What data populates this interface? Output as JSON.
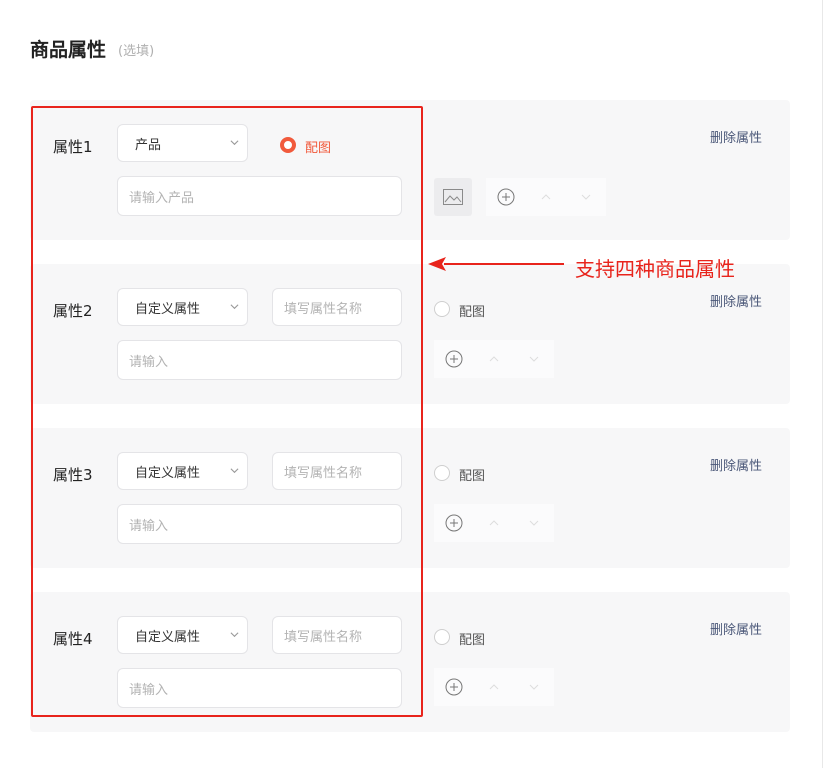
{
  "section": {
    "title": "商品属性",
    "hint": "(选填)"
  },
  "annotation": {
    "text": "支持四种商品属性",
    "color": "#e8241c"
  },
  "colors": {
    "accent": "#f15a3c",
    "link": "#4a5778",
    "card_bg": "#f7f7f8"
  },
  "attributes": [
    {
      "label": "属性1",
      "type": "产品",
      "name_placeholder": "",
      "value_placeholder": "请输入产品",
      "image_option": "配图",
      "image_option_selected": true,
      "delete": "删除属性"
    },
    {
      "label": "属性2",
      "type": "自定义属性",
      "name_placeholder": "填写属性名称",
      "value_placeholder": "请输入",
      "image_option": "配图",
      "image_option_selected": false,
      "delete": "删除属性"
    },
    {
      "label": "属性3",
      "type": "自定义属性",
      "name_placeholder": "填写属性名称",
      "value_placeholder": "请输入",
      "image_option": "配图",
      "image_option_selected": false,
      "delete": "删除属性"
    },
    {
      "label": "属性4",
      "type": "自定义属性",
      "name_placeholder": "填写属性名称",
      "value_placeholder": "请输入",
      "image_option": "配图",
      "image_option_selected": false,
      "delete": "删除属性"
    }
  ],
  "icons": {
    "dropdown": "chevron-down-icon",
    "image": "image-icon",
    "add": "plus-circle-icon",
    "up": "chevron-up-icon",
    "down": "chevron-down-icon",
    "arrow": "arrow-left-icon"
  }
}
